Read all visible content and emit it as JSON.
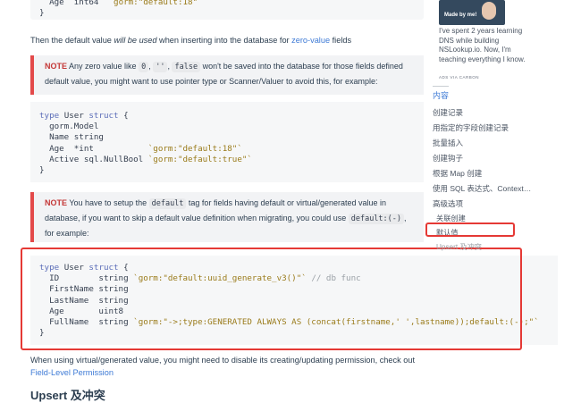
{
  "code_top": {
    "line": [
      "Age",
      "int64",
      "`gorm:\"default:18\"`"
    ],
    "brace": "}"
  },
  "para1": {
    "before": "Then the default value ",
    "italic": "will be used",
    "after": " when inserting into the database for ",
    "link": "zero-value",
    "end": " fields"
  },
  "note1": {
    "label": "NOTE",
    "t1": " Any zero value like ",
    "c1": "0",
    "t2": ", ",
    "c2": "''",
    "t3": ", ",
    "c3": "false",
    "t4": " won't be saved into the database for those fields defined default value, you might want to use pointer type or Scanner/Valuer to avoid this, for example:"
  },
  "code1": {
    "kw_type": "type",
    "name": "User",
    "kw_struct": "struct",
    "open": "{",
    "l1": "gorm.Model",
    "l2_field": "Name",
    "l2_type": "string",
    "l3_field": "Age",
    "l3_type": "*int",
    "l3_tag": "`gorm:\"default:18\"`",
    "l4_field": "Active",
    "l4_type": "sql.NullBool",
    "l4_tag": "`gorm:\"default:true\"`",
    "close": "}"
  },
  "note2": {
    "label": "NOTE",
    "t1": " You have to setup the ",
    "c1": "default",
    "t2": " tag for fields having default or virtual/generated value in database, if you want to skip a default value definition when migrating, you could use ",
    "c2": "default:(-)",
    "t3": ", for example:"
  },
  "code2": {
    "kw_type": "type",
    "name": "User",
    "kw_struct": "struct",
    "open": "{",
    "rows": [
      {
        "field": "ID",
        "type": "string",
        "tag": "`gorm:\"default:uuid_generate_v3()\"`",
        "comment": "// db func"
      },
      {
        "field": "FirstName",
        "type": "string",
        "tag": "",
        "comment": ""
      },
      {
        "field": "LastName",
        "type": "string",
        "tag": "",
        "comment": ""
      },
      {
        "field": "Age",
        "type": "uint8",
        "tag": "",
        "comment": ""
      },
      {
        "field": "FullName",
        "type": "string",
        "tag": "`gorm:\"->;type:GENERATED ALWAYS AS (concat(firstname,' ',lastname));default:(-);\"`",
        "comment": ""
      }
    ],
    "close": "}"
  },
  "para2": {
    "text": "When using virtual/generated value, you might need to disable its creating/updating permission, check out",
    "link": "Field-Level Permission"
  },
  "heading_upsert": "Upsert 及冲突",
  "ad": {
    "made_by": "Made by me!",
    "text": "I've spent 2 years learning DNS while building NSLookup.io. Now, I'm teaching everything I know.",
    "via": "ADS VIA CARBON"
  },
  "toc": {
    "title": "内容",
    "items": [
      {
        "label": "创建记录"
      },
      {
        "label": "用指定的字段创建记录"
      },
      {
        "label": "批量插入"
      },
      {
        "label": "创建钩子"
      },
      {
        "label": "根据 Map 创建"
      },
      {
        "label": "使用 SQL 表达式、Context…"
      },
      {
        "label": "高级选项"
      },
      {
        "label": "关联创建"
      },
      {
        "label": "默认值"
      },
      {
        "label": "Upsert 及冲突"
      }
    ]
  },
  "colors": {
    "accent_link": "#3f7bd6",
    "note_border": "#e34a4a",
    "highlight_box": "#e53935"
  }
}
